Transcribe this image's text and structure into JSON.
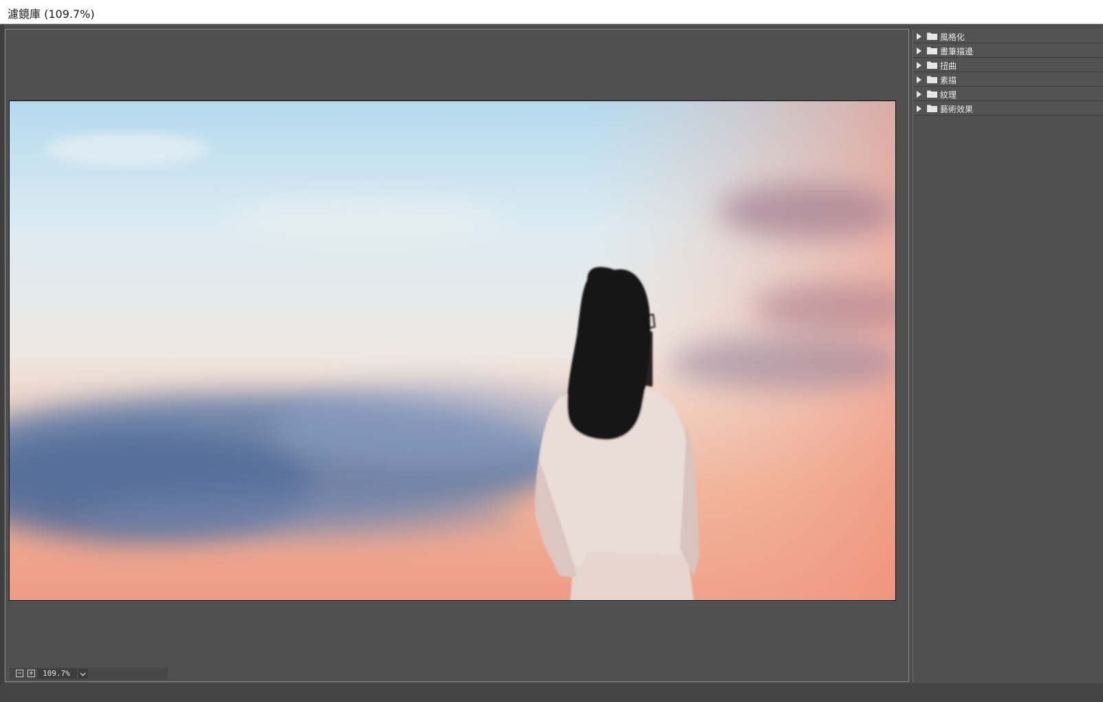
{
  "window": {
    "title": "濾鏡庫 (109.7%)"
  },
  "zoom": {
    "value": "109.7%",
    "minus_icon": "zoom-out-icon",
    "plus_icon": "zoom-in-icon",
    "dropdown_icon": "chevron-down-icon"
  },
  "filter_categories": [
    {
      "label": "風格化"
    },
    {
      "label": "畫筆描邊"
    },
    {
      "label": "扭曲"
    },
    {
      "label": "素描"
    },
    {
      "label": "紋理"
    },
    {
      "label": "藝術效果"
    }
  ],
  "colors": {
    "panel_bg": "#505050",
    "app_bg": "#4d4d4d",
    "text": "#eaeaea"
  }
}
